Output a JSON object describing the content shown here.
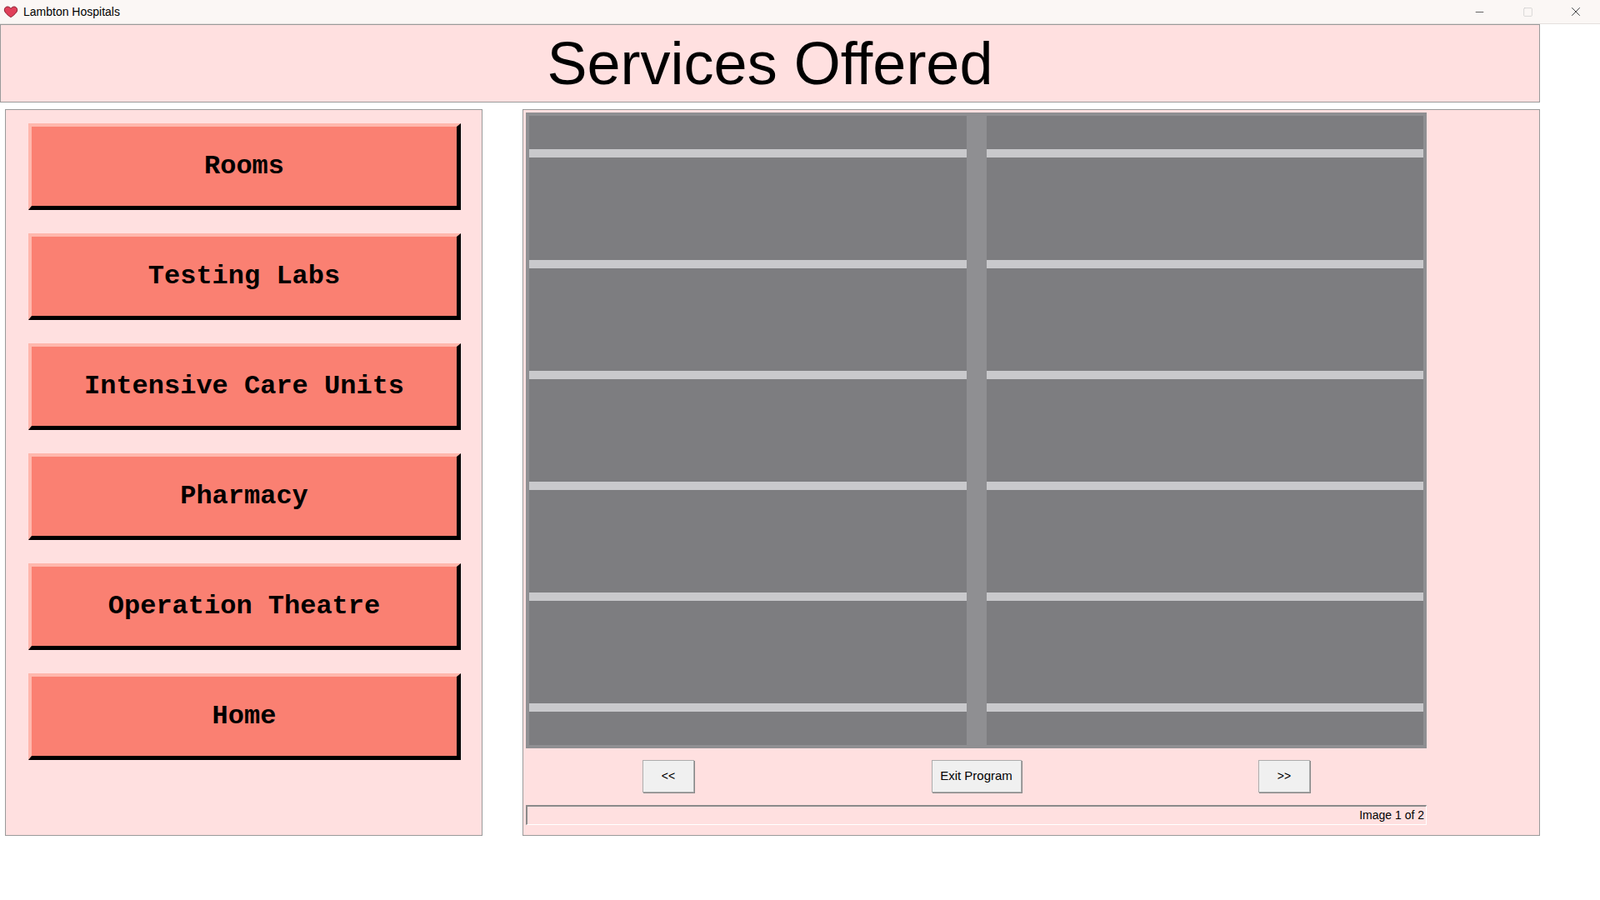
{
  "window": {
    "title": "Lambton Hospitals",
    "maximize_disabled": true
  },
  "header": {
    "title": "Services Offered"
  },
  "menu": [
    {
      "label": "Rooms"
    },
    {
      "label": "Testing Labs"
    },
    {
      "label": "Intensive Care Units"
    },
    {
      "label": "Pharmacy"
    },
    {
      "label": "Operation Theatre"
    },
    {
      "label": "Home"
    }
  ],
  "viewer": {
    "prev": "<<",
    "exit": "Exit Program",
    "next": ">>"
  },
  "status_bar": {
    "text": "Image 1 of 2"
  }
}
